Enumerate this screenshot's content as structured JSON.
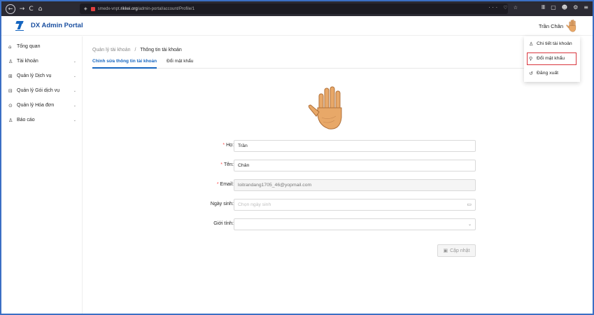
{
  "browser": {
    "url_prefix": "smedx-vnpt.",
    "url_domain": "rikkei.org",
    "url_path": "/admin-portal/account/Profile/1",
    "nav_back": "←",
    "nav_forward": "→",
    "nav_reload": "C",
    "nav_home": "⌂",
    "url_actions": "··· ♡ ☆",
    "right_icons": [
      "Ⅲ",
      "▢",
      "☻",
      "⚙",
      "≡"
    ]
  },
  "header": {
    "logo_text": "DX Admin Portal",
    "user_name": "Trần Chân"
  },
  "sidebar": {
    "items": [
      {
        "label": "Tổng quan",
        "icon": "home-icon",
        "glyph": "⌂",
        "has_chevron": false
      },
      {
        "label": "Tài khoản",
        "icon": "user-icon",
        "glyph": "♙",
        "has_chevron": true
      },
      {
        "label": "Quản lý Dịch vụ",
        "icon": "grid-icon",
        "glyph": "⊞",
        "has_chevron": true
      },
      {
        "label": "Quản lý Gói dịch vụ",
        "icon": "package-icon",
        "glyph": "⊟",
        "has_chevron": true
      },
      {
        "label": "Quản lý Hóa đơn",
        "icon": "invoice-icon",
        "glyph": "⊙",
        "has_chevron": true
      },
      {
        "label": "Báo cáo",
        "icon": "report-icon",
        "glyph": "♙",
        "has_chevron": true
      }
    ],
    "chevron": "⌄"
  },
  "breadcrumb": {
    "parent": "Quản lý tài khoản",
    "separator": "/",
    "current": "Thông tin tài khoản"
  },
  "tabs": [
    {
      "label": "Chỉnh sửa thông tin tài khoản",
      "active": true
    },
    {
      "label": "Đổi mật khẩu",
      "active": false
    }
  ],
  "form": {
    "ho_label": "Họ:",
    "ho_value": "Trần",
    "ten_label": "Tên:",
    "ten_value": "Chân",
    "email_label": "Email:",
    "email_value": "loitrandang1705_46@yopmail.com",
    "ngaysinh_label": "Ngày sinh:",
    "ngaysinh_placeholder": "Chọn ngày sinh",
    "gioitinh_label": "Giới tính:",
    "gioitinh_value": "",
    "required_mark": "*",
    "submit_label": "Cập nhật"
  },
  "dropdown": {
    "items": [
      {
        "label": "Chi tiết tài khoản",
        "icon": "user-icon",
        "glyph": "♙"
      },
      {
        "label": "Đổi mật khẩu",
        "icon": "key-icon",
        "glyph": "⚲"
      },
      {
        "label": "Đăng xuất",
        "icon": "logout-icon",
        "glyph": "↺"
      }
    ]
  },
  "colors": {
    "primary": "#1565c0",
    "required": "#ff4d4f",
    "highlight": "#d9363e",
    "browser_bg": "#2b2a33"
  }
}
